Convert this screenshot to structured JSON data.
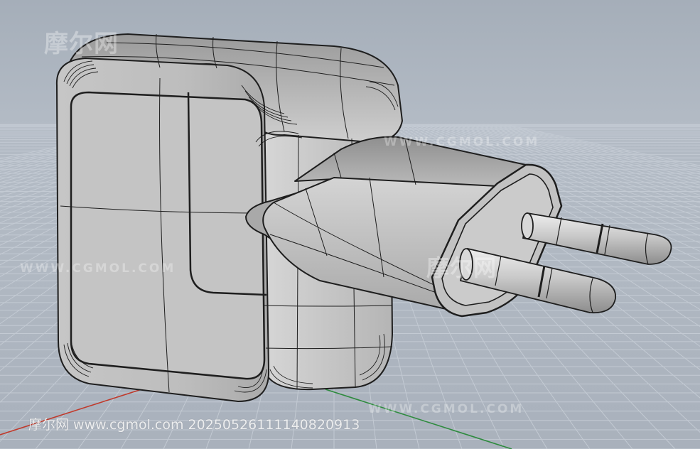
{
  "viewport": {
    "view": "Perspective",
    "display_mode": "Shaded with wireframe isocurves",
    "grid": true,
    "axis_colors": {
      "x": "#c0392b",
      "y": "#2e8b3e"
    },
    "background": "#aeb6c0",
    "object_color": "#c9c9c9"
  },
  "model": {
    "body": {
      "name": "adapter-body-icon"
    },
    "plug_head": {
      "name": "plug-head-icon"
    },
    "pins": [
      {
        "name": "pin-upper-icon"
      },
      {
        "name": "pin-lower-icon"
      }
    ]
  },
  "watermarks": {
    "logo_text": "摩尔网",
    "url_upper": "WWW.CGMOL.COM",
    "url_left": "WWW.CGMOL.COM",
    "url_bottom": "WWW.CGMOL.COM",
    "stamp": "摩尔网 www.cgmol.com 20250526111140820913"
  }
}
